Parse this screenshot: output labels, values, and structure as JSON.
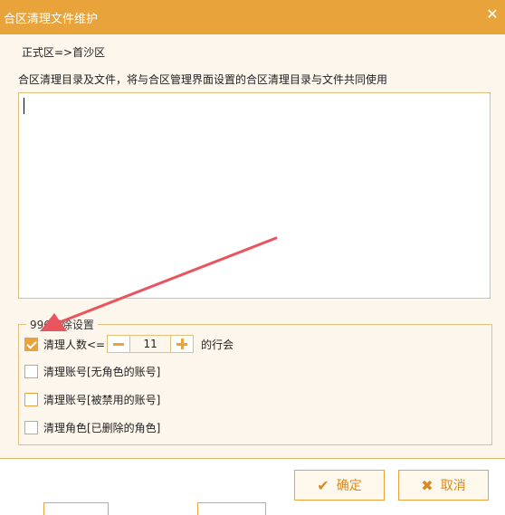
{
  "window": {
    "title": "合区清理文件维护"
  },
  "breadcrumb": "正式区=>首沙区",
  "description": "合区清理目录及文件，将与合区管理界面设置的合区清理目录与文件共同使用",
  "textarea": {
    "value": ""
  },
  "settings": {
    "legend": "996清除设置",
    "rows": [
      {
        "label": "清理人数<=",
        "checked": true,
        "value": "11",
        "suffix": "的行会"
      },
      {
        "label": "清理账号[无角色的账号]",
        "checked": false
      },
      {
        "label": "清理账号[被禁用的账号]",
        "checked": false
      },
      {
        "label": "清理角色[已删除的角色]",
        "checked": false
      }
    ]
  },
  "buttons": {
    "ok": "确定",
    "cancel": "取消"
  },
  "colors": {
    "accent": "#e8a43a",
    "annotation": "#e9555e"
  }
}
